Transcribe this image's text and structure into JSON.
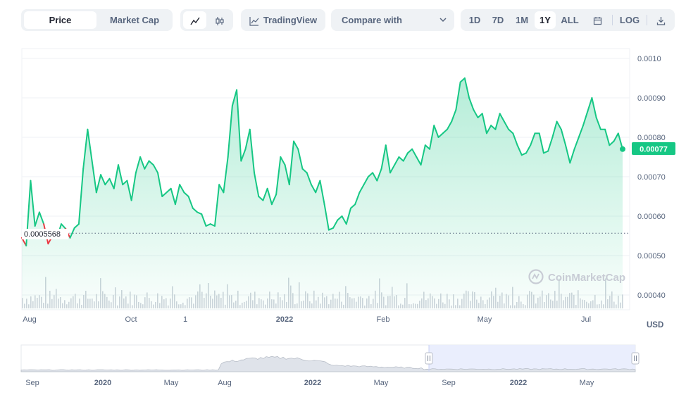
{
  "toolbar": {
    "tabs": [
      "Price",
      "Market Cap"
    ],
    "active_tab": "Price",
    "chart_type_icons": [
      "line-chart-icon",
      "candlestick-icon"
    ],
    "tradingview_label": "TradingView",
    "compare_label": "Compare with",
    "ranges": [
      "1D",
      "7D",
      "1M",
      "1Y",
      "ALL"
    ],
    "active_range": "1Y",
    "calendar_icon": "calendar-icon",
    "log_label": "LOG",
    "download_icon": "download-icon"
  },
  "watermark": "CoinMarketCap",
  "colors": {
    "up": "#16c784",
    "down": "#ea3943",
    "grid": "#eff2f5",
    "nav_selection": "#e8ecfd"
  },
  "chart_data": {
    "type": "area",
    "currency_label": "USD",
    "y_ticks": [
      "0.0010",
      "0.00090",
      "0.00080",
      "0.00070",
      "0.00060",
      "0.00050",
      "0.00040"
    ],
    "ylim": [
      0.00038,
      0.00104
    ],
    "x_ticks": [
      "Aug",
      "Oct",
      "1",
      "2022",
      "Feb",
      "May",
      "Jul"
    ],
    "reference_price": "0.0005568",
    "reference_value": 0.0005568,
    "current_price": "0.00077",
    "series": [
      {
        "values": [
          0.000545,
          0.000525,
          0.00069,
          0.000575,
          0.00061,
          0.00058,
          0.00053,
          0.00055,
          0.000545,
          0.00058,
          0.000568,
          0.000545,
          0.00057,
          0.00058,
          0.00072,
          0.00082,
          0.00074,
          0.00066,
          0.000705,
          0.00068,
          0.000695,
          0.00067,
          0.00073,
          0.00068,
          0.00069,
          0.00064,
          0.00071,
          0.00075,
          0.00072,
          0.00074,
          0.00073,
          0.00071,
          0.00065,
          0.00066,
          0.00067,
          0.00063,
          0.00068,
          0.00066,
          0.00065,
          0.00062,
          0.00061,
          0.000605,
          0.000575,
          0.00058,
          0.000575,
          0.00068,
          0.00066,
          0.00075,
          0.00088,
          0.00092,
          0.00074,
          0.00077,
          0.00082,
          0.00071,
          0.00065,
          0.00064,
          0.00067,
          0.00063,
          0.000655,
          0.00075,
          0.00073,
          0.00068,
          0.00079,
          0.00077,
          0.00072,
          0.00071,
          0.00068,
          0.00066,
          0.00069,
          0.00063,
          0.000565,
          0.00057,
          0.00059,
          0.0006,
          0.00058,
          0.00062,
          0.00063,
          0.00066,
          0.00068,
          0.0007,
          0.00071,
          0.00069,
          0.00072,
          0.00078,
          0.00071,
          0.00073,
          0.00075,
          0.00074,
          0.00076,
          0.00077,
          0.00075,
          0.00073,
          0.00078,
          0.00077,
          0.00083,
          0.0008,
          0.00081,
          0.00082,
          0.00084,
          0.00087,
          0.00094,
          0.00095,
          0.0009,
          0.00087,
          0.00085,
          0.00086,
          0.00081,
          0.00083,
          0.00082,
          0.00086,
          0.00084,
          0.00082,
          0.00081,
          0.00078,
          0.000755,
          0.00076,
          0.00078,
          0.00081,
          0.00081,
          0.00076,
          0.000765,
          0.0008,
          0.00084,
          0.00082,
          0.00078,
          0.000735,
          0.00077,
          0.0008,
          0.00083,
          0.000865,
          0.0009,
          0.00085,
          0.00082,
          0.00082,
          0.00078,
          0.00079,
          0.00081,
          0.00077
        ]
      }
    ],
    "navigator": {
      "x_ticks": [
        "Sep",
        "2020",
        "May",
        "Aug",
        "2022",
        "May",
        "Sep",
        "2022",
        "May"
      ]
    }
  }
}
